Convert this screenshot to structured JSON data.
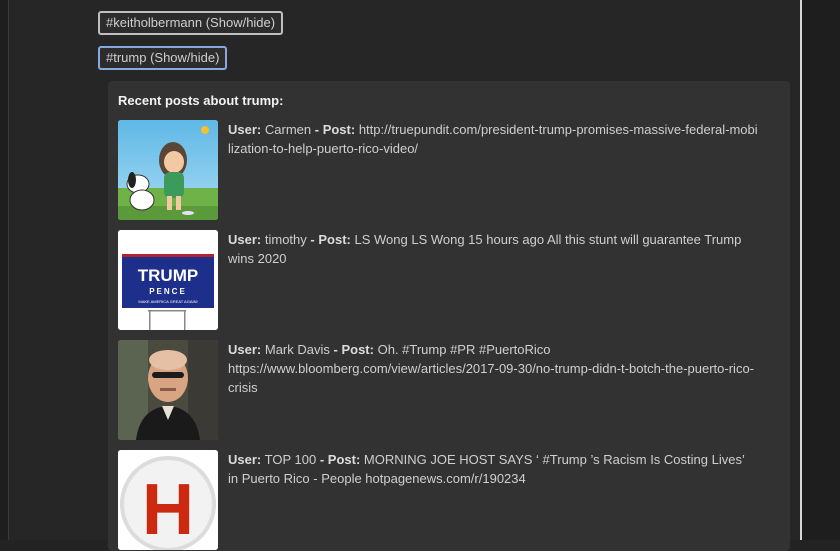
{
  "tags": [
    {
      "label": "#keitholbermann (Show/hide)"
    },
    {
      "label": "#trump (Show/hide)"
    }
  ],
  "panel": {
    "title": "Recent posts about trump:",
    "user_label": "User:",
    "post_label": "- Post:"
  },
  "posts": [
    {
      "user": "Carmen",
      "text": "http://truepundit.com/president-trump-promises-massive-federal-mobilization-to-help-puerto-rico-video/",
      "thumb": "peanuts-cartoon-image"
    },
    {
      "user": "timothy",
      "text": "LS Wong LS Wong 15 hours ago All this stunt will guarantee Trump wins 2020",
      "thumb": "trump-pence-yard-sign-image",
      "sign": {
        "line1": "TRUMP",
        "line2": "PENCE",
        "line3": "MAKE AMERICA GREAT AGAIN!"
      }
    },
    {
      "user": "Mark Davis",
      "text": "Oh. #Trump #PR #PuertoRico https://www.bloomberg.com/view/articles/2017-09-30/no-trump-didn-t-botch-the-puerto-rico-crisis",
      "thumb": "man-portrait-image"
    },
    {
      "user": "TOP 100",
      "text": "MORNING JOE HOST SAYS ‘ #Trump ’s Racism Is Costing Lives’ in Puerto Rico - People hotpagenews.com/r/190234",
      "thumb": "h-logo-image",
      "logo_letter": "H"
    }
  ]
}
